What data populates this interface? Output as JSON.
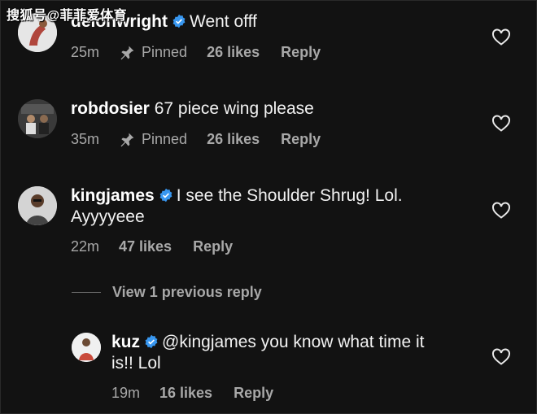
{
  "watermark": "搜狐号@菲菲爱体育",
  "comments": [
    {
      "username": "deionwright",
      "verified": true,
      "text": "Went offf",
      "time": "25m",
      "pinned_label": "Pinned",
      "likes": "26 likes",
      "reply_label": "Reply"
    },
    {
      "username": "robdosier",
      "verified": false,
      "text": "67 piece wing please",
      "time": "35m",
      "pinned_label": "Pinned",
      "likes": "26 likes",
      "reply_label": "Reply"
    },
    {
      "username": "kingjames",
      "verified": true,
      "text_line1": "I see the Shoulder Shrug! Lol.",
      "text_line2": "Ayyyyeee",
      "time": "22m",
      "likes": "47 likes",
      "reply_label": "Reply"
    }
  ],
  "view_previous": "View 1 previous reply",
  "reply": {
    "username": "kuz",
    "verified": true,
    "text_line1": "@kingjames you know what time it",
    "text_line2": "is!! Lol",
    "time": "19m",
    "likes": "16 likes",
    "reply_label": "Reply"
  },
  "icons": {
    "verified": "verified-badge-icon",
    "pin": "pin-icon",
    "heart": "heart-outline-icon"
  },
  "colors": {
    "background": "#121212",
    "verified_blue": "#3897f0",
    "meta_gray": "#a8a8a8"
  }
}
